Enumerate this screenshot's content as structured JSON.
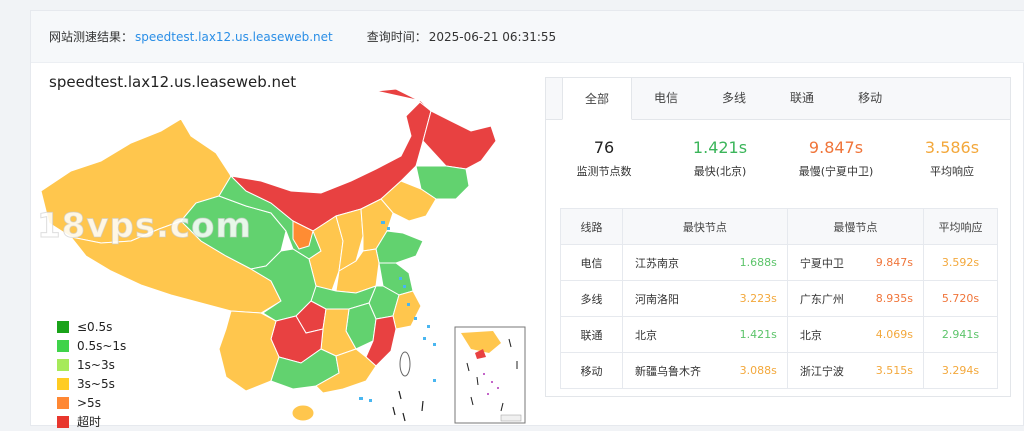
{
  "result_bar": {
    "label": "网站测速结果：",
    "url": "speedtest.lax12.us.leaseweb.net",
    "query_label": "查询时间：",
    "query_time": "2025-06-21 06:31:55"
  },
  "host_title": "speedtest.lax12.us.leaseweb.net",
  "watermark": "18vps.com",
  "legend": [
    {
      "label": "≤0.5s",
      "color": "#1aa31a"
    },
    {
      "label": "0.5s~1s",
      "color": "#3fd34a"
    },
    {
      "label": "1s~3s",
      "color": "#a6ea5a"
    },
    {
      "label": "3s~5s",
      "color": "#ffcc22"
    },
    {
      "label": ">5s",
      "color": "#ff8833"
    },
    {
      "label": "超时",
      "color": "#e8372e"
    }
  ],
  "colors": {
    "green": "#62d26f",
    "yellow": "#ffc64d",
    "orange": "#ff8c33",
    "red": "#e84141",
    "sea": "#49b6f0"
  },
  "tabs": [
    "全部",
    "电信",
    "多线",
    "联通",
    "移动"
  ],
  "active_tab": "全部",
  "stats": [
    {
      "value": "76",
      "label": "监测节点数",
      "color": "#222"
    },
    {
      "value": "1.421s",
      "label": "最快(北京)",
      "color": "#3bb55a"
    },
    {
      "value": "9.847s",
      "label": "最慢(宁夏中卫)",
      "color": "#f0753a"
    },
    {
      "value": "3.586s",
      "label": "平均响应",
      "color": "#f3a83c"
    }
  ],
  "table": {
    "headers": [
      "线路",
      "最快节点",
      "最慢节点",
      "平均响应"
    ],
    "rows": [
      {
        "line": "电信",
        "fast_city": "江苏南京",
        "fast_time": "1.688s",
        "slow_city": "宁夏中卫",
        "slow_time": "9.847s",
        "avg": "3.592s"
      },
      {
        "line": "多线",
        "fast_city": "河南洛阳",
        "fast_time": "3.223s",
        "slow_city": "广东广州",
        "slow_time": "8.935s",
        "avg": "5.720s"
      },
      {
        "line": "联通",
        "fast_city": "北京",
        "fast_time": "1.421s",
        "slow_city": "北京",
        "slow_time": "4.069s",
        "avg": "2.941s"
      },
      {
        "line": "移动",
        "fast_city": "新疆乌鲁木齐",
        "fast_time": "3.088s",
        "slow_city": "浙江宁波",
        "slow_time": "3.515s",
        "avg": "3.294s"
      }
    ]
  }
}
